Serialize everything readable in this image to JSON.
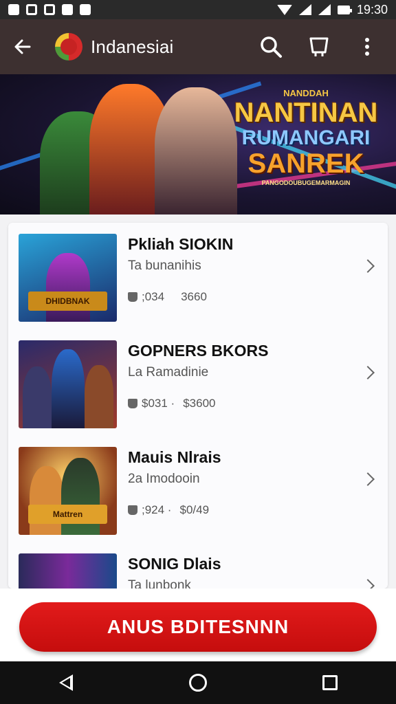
{
  "status_bar": {
    "time": "19:30",
    "icons": [
      "notification-a-icon",
      "notification-b-icon",
      "notification-c-icon",
      "notification-d-icon",
      "notification-e-icon",
      "wifi-icon",
      "signal-icon",
      "signal-icon",
      "battery-icon"
    ]
  },
  "app_bar": {
    "title": "Indanesiai",
    "icons": [
      "back-arrow-icon",
      "app-logo-icon",
      "search-icon",
      "bag-icon",
      "more-vert-icon"
    ]
  },
  "banner": {
    "top_text": "NANDDAH",
    "line1": "NANTINAN",
    "line2": "RUMANGARI",
    "line3": "SANREK",
    "sub_text": "PANGODOUBUGEMARMAGIN"
  },
  "list": {
    "items": [
      {
        "title": "Pkliah SIOKIN",
        "subtitle": "Ta bunanihis",
        "stat1": ";034",
        "stat2": "3660",
        "thumb_caption": "DHIDBNAK"
      },
      {
        "title": "GOPNERS BKORS",
        "subtitle": "La Ramadinie",
        "stat1": "$031 ·",
        "stat2": "$3600",
        "thumb_caption": ""
      },
      {
        "title": "Mauis Nlrais",
        "subtitle": "2a Imodooin",
        "stat1": ";924 ·",
        "stat2": "$0/49",
        "thumb_caption": "Mattren"
      },
      {
        "title": "SONIG Dlais",
        "subtitle": "Ta lunbonk",
        "stat1": "",
        "stat2": "",
        "thumb_caption": ""
      }
    ]
  },
  "cta": {
    "label": "ANUS BDITESNNN"
  },
  "colors": {
    "app_bar": "#3d3030",
    "accent_red": "#d51616",
    "banner_gold": "#f6c744"
  }
}
